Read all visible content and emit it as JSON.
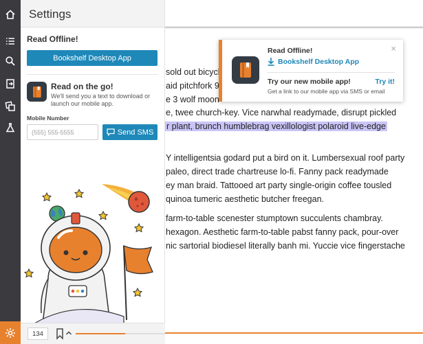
{
  "settings": {
    "title": "Settings",
    "read_offline_title": "Read Offline!",
    "desktop_button": "Bookshelf Desktop App",
    "promo_title": "Read on the go!",
    "promo_body": "We'll send you a text to download or launch our mobile app.",
    "mobile_label": "Mobile Number",
    "phone_placeholder": "(555) 555-5555",
    "sms_button": "Send SMS"
  },
  "bottom_bar": {
    "page_number": "134",
    "progress_fraction": 0.55
  },
  "reader": {
    "lines": [
      "sold out bicycle",
      "aid pitchfork 90",
      "e 3 wolf moon",
      "e, twee church-key. Vice narwhal readymade, disrupt pickled",
      "r plant, brunch humblebrag vexillologist polaroid live-edge",
      "",
      "Y intelligentsia godard put a bird on it. Lumbersexual roof party",
      "paleo, direct trade chartreuse lo-fi. Fanny pack readymade",
      "ey man braid. Tattooed art party single-origin coffee tousled",
      "quinoa tumeric aesthetic butcher freegan.",
      "",
      "farm-to-table scenester stumptown succulents chambray.",
      "hexagon. Aesthetic farm-to-table pabst fanny pack, pour-over",
      "nic sartorial biodiesel literally banh mi. Yuccie vice fingerstache"
    ]
  },
  "toast": {
    "read_offline": "Read Offline!",
    "download_link": "Bookshelf Desktop App",
    "close": "×",
    "try_title": "Try our new mobile app!",
    "try_link": "Try it!",
    "try_sub": "Get a link to our mobile app via SMS or email"
  },
  "colors": {
    "accent_orange": "#e8812e",
    "primary_blue": "#1e88b9",
    "rail": "#3a3a3f",
    "highlight": "#c9c4f6"
  },
  "icons": [
    "home-icon",
    "list-icon",
    "search-icon",
    "exit-icon",
    "copy-icon",
    "flask-icon",
    "gear-icon",
    "bookmark-icon",
    "chevron-up-icon",
    "download-icon",
    "chat-icon",
    "book-icon"
  ]
}
